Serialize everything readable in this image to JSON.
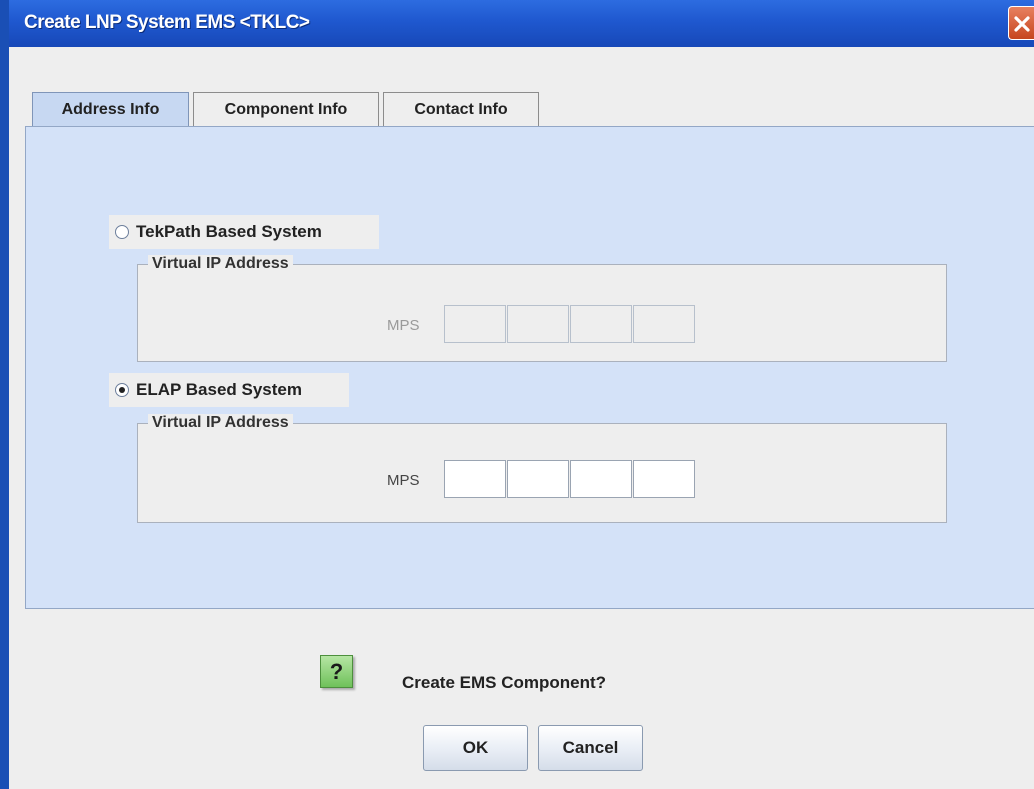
{
  "window": {
    "title": "Create LNP System EMS <TKLC>",
    "close_icon": "close-icon",
    "close_color": "#d65a34"
  },
  "tabs": [
    {
      "label": "Address Info",
      "active": true
    },
    {
      "label": "Component Info",
      "active": false
    },
    {
      "label": "Contact Info",
      "active": false
    }
  ],
  "address": {
    "tekpath": {
      "label": "TekPath Based System",
      "selected": false,
      "group_title": "Virtual IP Address",
      "mps_label": "MPS",
      "ip_octets": [
        "",
        "",
        "",
        ""
      ],
      "enabled": false
    },
    "elap": {
      "label": "ELAP Based System",
      "selected": true,
      "group_title": "Virtual IP Address",
      "mps_label": "MPS",
      "ip_octets": [
        "",
        "",
        "",
        ""
      ],
      "enabled": true
    }
  },
  "prompt": {
    "icon": "question-icon",
    "icon_glyph": "?",
    "text": "Create EMS Component?",
    "ok_label": "OK",
    "cancel_label": "Cancel"
  },
  "colors": {
    "titlebar": "#1f58cf",
    "panel": "#d4e2f8",
    "icon_green": "#6fc15a"
  }
}
